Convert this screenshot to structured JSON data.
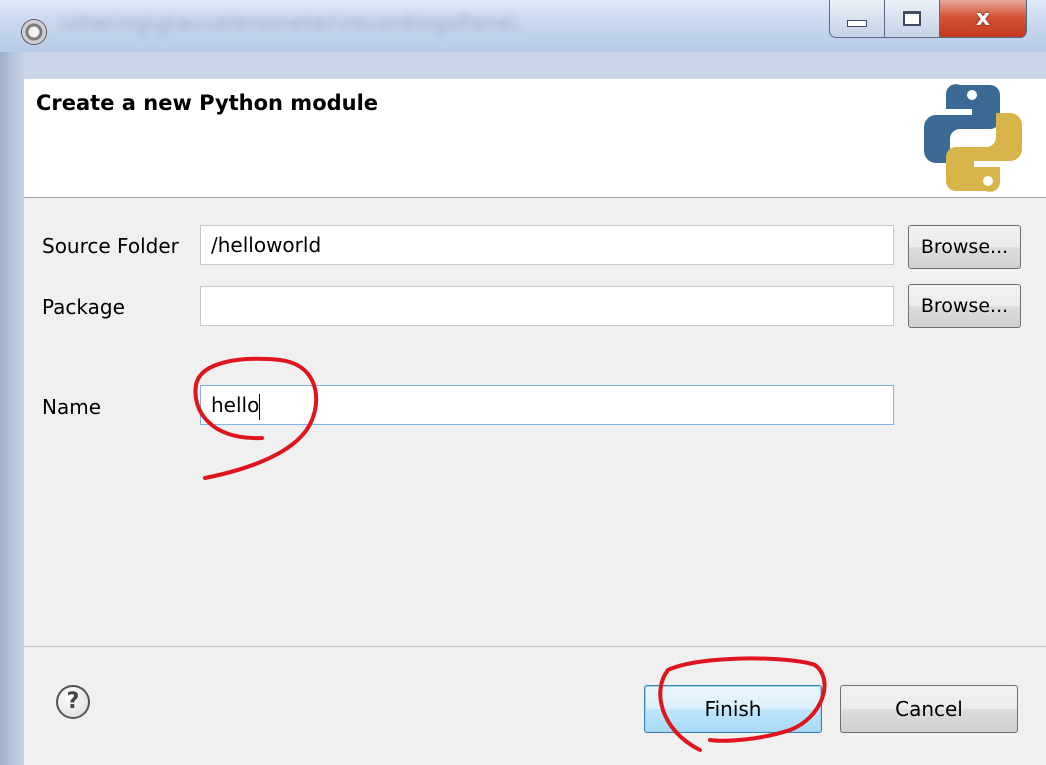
{
  "titlebar": {
    "blurred_path": "\\sharing\\g\\accelerometer\\recordingsPane\\",
    "icons": {
      "app": "eclipse-app-icon",
      "minimize": "minimize-icon",
      "maximize": "maximize-icon",
      "close": "close-icon"
    },
    "close_glyph": "x"
  },
  "header": {
    "title": "Create a new Python module",
    "logo": "python-logo-icon",
    "logo_colors": {
      "blue": "#3b6b94",
      "yellow": "#d8b54a"
    }
  },
  "form": {
    "source_folder": {
      "label": "Source Folder",
      "value": "/helloworld",
      "browse_label": "Browse..."
    },
    "package": {
      "label": "Package",
      "value": "",
      "browse_label": "Browse..."
    },
    "name": {
      "label": "Name",
      "value": "hello"
    }
  },
  "footer": {
    "help_glyph": "?",
    "help_icon": "help-icon",
    "finish_label": "Finish",
    "cancel_label": "Cancel"
  },
  "annotation_color": "#e0141c"
}
